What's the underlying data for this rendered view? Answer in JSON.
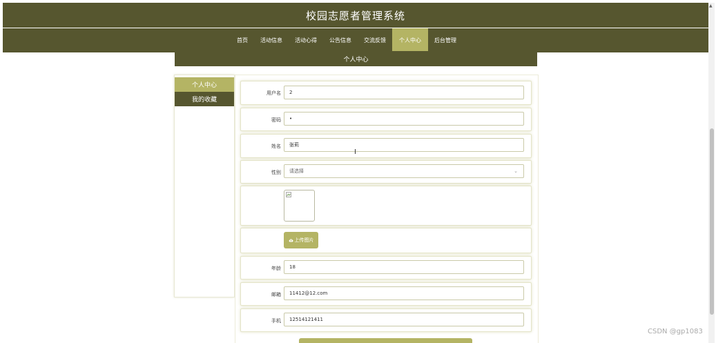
{
  "header": {
    "title": "校园志愿者管理系统"
  },
  "nav": {
    "items": [
      {
        "label": "首页"
      },
      {
        "label": "活动信息"
      },
      {
        "label": "活动心得"
      },
      {
        "label": "公告信息"
      },
      {
        "label": "交流反馈"
      },
      {
        "label": "个人中心",
        "active": true
      },
      {
        "label": "后台管理"
      }
    ]
  },
  "section": {
    "title": "个人中心"
  },
  "sidebar": {
    "items": [
      {
        "label": "个人中心",
        "active": true
      },
      {
        "label": "我的收藏"
      }
    ]
  },
  "form": {
    "username": {
      "label": "用户名",
      "value": "2"
    },
    "password": {
      "label": "密码",
      "value": "•"
    },
    "name": {
      "label": "姓名",
      "value": "张莉"
    },
    "gender": {
      "label": "性别",
      "placeholder": "请选择"
    },
    "upload_button": {
      "label": "上传图片"
    },
    "age": {
      "label": "年龄",
      "value": "18"
    },
    "email": {
      "label": "邮箱",
      "value": "11412@12.com"
    },
    "phone": {
      "label": "手机",
      "value": "12514121411"
    }
  },
  "colors": {
    "primary": "#56562f",
    "accent": "#b4b464"
  },
  "watermark": "CSDN @gp1083"
}
